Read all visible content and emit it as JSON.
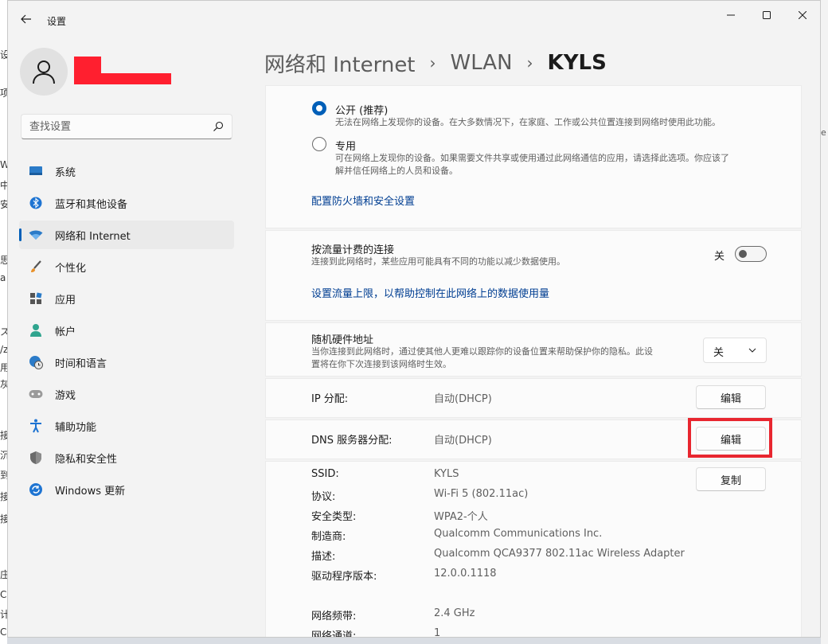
{
  "window": {
    "title": "设置"
  },
  "sidebar": {
    "search_placeholder": "查找设置",
    "items": [
      {
        "label": "系统",
        "icon": "system-icon"
      },
      {
        "label": "蓝牙和其他设备",
        "icon": "bluetooth-icon"
      },
      {
        "label": "网络和 Internet",
        "icon": "wifi-icon",
        "active": true
      },
      {
        "label": "个性化",
        "icon": "brush-icon"
      },
      {
        "label": "应用",
        "icon": "apps-icon"
      },
      {
        "label": "帐户",
        "icon": "account-icon"
      },
      {
        "label": "时间和语言",
        "icon": "globe-clock-icon"
      },
      {
        "label": "游戏",
        "icon": "gamepad-icon"
      },
      {
        "label": "辅助功能",
        "icon": "accessibility-icon"
      },
      {
        "label": "隐私和安全性",
        "icon": "shield-icon"
      },
      {
        "label": "Windows 更新",
        "icon": "update-icon"
      }
    ]
  },
  "breadcrumb": {
    "part1": "网络和 Internet",
    "part2": "WLAN",
    "current": "KYLS",
    "separator": "›"
  },
  "network_profile": {
    "public_title": "公开 (推荐)",
    "public_desc": "无法在网络上发现你的设备。在大多数情况下，在家庭、工作或公共位置连接到网络时使用此功能。",
    "private_title": "专用",
    "private_desc_line1": "可在网络上发现你的设备。如果需要文件共享或使用通过此网络通信的应用，请选择此选项。你应该了",
    "private_desc_line2": "解并信任网络上的人员和设备。",
    "selected": "public",
    "firewall_link": "配置防火墙和安全设置"
  },
  "metered": {
    "title": "按流量计费的连接",
    "desc": "连接到此网络时，某些应用可能具有不同的功能以减少数据使用。",
    "state_label": "关",
    "state": false,
    "limit_link": "设置流量上限，以帮助控制在此网络上的数据使用量"
  },
  "random_mac": {
    "title": "随机硬件地址",
    "desc_line1": "当你连接到此网络时，通过使其他人更难以跟踪你的设备位置来帮助保护你的隐私。此设",
    "desc_line2": "置将在你下次连接到该网络时生效。",
    "value": "关"
  },
  "ip_assignment": {
    "label": "IP 分配:",
    "value": "自动(DHCP)",
    "button": "编辑"
  },
  "dns_assignment": {
    "label": "DNS 服务器分配:",
    "value": "自动(DHCP)",
    "button": "编辑"
  },
  "properties": {
    "copy_button": "复制",
    "rows": [
      {
        "key": "SSID:",
        "value": "KYLS"
      },
      {
        "key": "协议:",
        "value": "Wi-Fi 5 (802.11ac)"
      },
      {
        "key": "安全类型:",
        "value": "WPA2-个人"
      },
      {
        "key": "制造商:",
        "value": "Qualcomm Communications Inc."
      },
      {
        "key": "描述:",
        "value": "Qualcomm QCA9377 802.11ac Wireless Adapter"
      },
      {
        "key": "驱动程序版本:",
        "value": "12.0.0.1118"
      }
    ],
    "rows2": [
      {
        "key": "网络频带:",
        "value": "2.4 GHz"
      },
      {
        "key": "网络通道:",
        "value": "1"
      }
    ]
  },
  "colors": {
    "accent": "#005fb8",
    "highlight": "#e8262f",
    "redaction": "#ff1f2f",
    "link": "#003e92"
  }
}
